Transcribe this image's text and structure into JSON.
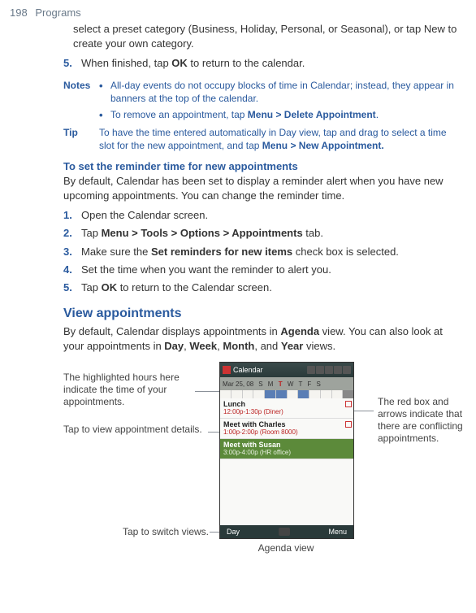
{
  "header": {
    "page_number": "198",
    "page_title": "Programs"
  },
  "intro": "select a preset category (Business, Holiday, Personal, or Seasonal), or tap New to create your own category.",
  "step5": {
    "num": "5.",
    "text_a": "When finished, tap ",
    "bold_a": "OK",
    "text_b": " to return to the calendar."
  },
  "notes_label": "Notes",
  "note1": "All-day events do not occupy blocks of time in Calendar; instead, they appear in banners at the top of the calendar.",
  "note2_a": "To remove an appointment, tap ",
  "note2_b": "Menu > Delete Appointment",
  "note2_c": ".",
  "tip_label": "Tip",
  "tip_a": "To have the time entered automatically in Day view, tap and drag to select a time slot for the new appointment, and tap ",
  "tip_b": "Menu > New Appointment.",
  "section_sub": "To set the reminder time for new appointments",
  "reminder_para": "By default, Calendar has been set to display a reminder alert when you have new upcoming appointments. You can change the reminder time.",
  "r_steps": {
    "s1": {
      "num": "1.",
      "text": "Open the Calendar screen."
    },
    "s2": {
      "num": "2.",
      "a": "Tap ",
      "b": "Menu > Tools > Options > Appointments",
      "c": " tab."
    },
    "s3": {
      "num": "3.",
      "a": "Make sure the ",
      "b": "Set reminders for new items",
      "c": " check box is selected."
    },
    "s4": {
      "num": "4.",
      "text": "Set the time when you want the reminder to alert you."
    },
    "s5": {
      "num": "5.",
      "a": "Tap ",
      "b": "OK",
      "c": " to return to the Calendar screen."
    }
  },
  "view_h2": "View appointments",
  "view_para_a": "By default, Calendar displays appointments in ",
  "view_para_b": "Agenda",
  "view_para_c": " view. You can also look at your appointments in ",
  "view_para_d": "Day",
  "view_para_e": ", ",
  "view_para_f": "Week",
  "view_para_g": ", ",
  "view_para_h": "Month",
  "view_para_i": ", and ",
  "view_para_j": "Year",
  "view_para_k": " views.",
  "annotations": {
    "left1": "The highlighted hours here indicate the time of your appointments.",
    "left2": "Tap to view appointment details.",
    "right1": "The red box and arrows indicate that there are conflicting appointments.",
    "bottom": "Tap to switch views.",
    "caption": "Agenda view"
  },
  "screen": {
    "title": "Calendar",
    "date": "Mar 25, 08",
    "days_before": "S M ",
    "days_today": "T",
    "days_after": " W T F S",
    "appts": [
      {
        "title": "Lunch",
        "time": "12:00p-1:30p (Diner)"
      },
      {
        "title": "Meet with Charles",
        "time": "1:00p-2:00p (Room 8000)"
      },
      {
        "title": "Meet with Susan",
        "time": "3:00p-4:00p (HR office)"
      }
    ],
    "soft_left": "Day",
    "soft_right": "Menu"
  }
}
